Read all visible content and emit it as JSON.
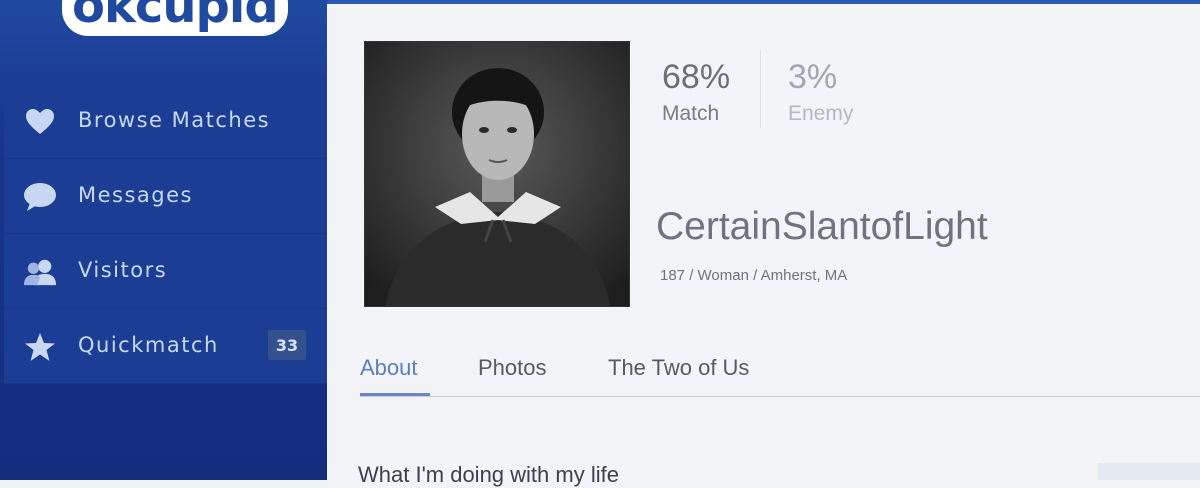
{
  "app": {
    "logo_text": "okcupid"
  },
  "sidebar": {
    "items": [
      {
        "label": "Browse Matches",
        "icon": "heart-icon"
      },
      {
        "label": "Messages",
        "icon": "chat-bubble-icon"
      },
      {
        "label": "Visitors",
        "icon": "people-icon"
      },
      {
        "label": "Quickmatch",
        "icon": "star-icon",
        "count": "33"
      }
    ]
  },
  "profile": {
    "stats": {
      "match_value": "68%",
      "match_label": "Match",
      "enemy_value": "3%",
      "enemy_label": "Enemy"
    },
    "username": "CertainSlantofLight",
    "details": "187 / Woman / Amherst, MA"
  },
  "tabs": [
    {
      "label": "About",
      "active": true
    },
    {
      "label": "Photos",
      "active": false
    },
    {
      "label": "The Two of Us",
      "active": false
    }
  ],
  "content": {
    "section_heading": "What I'm doing with my life"
  },
  "colors": {
    "sidebar": "#17358a",
    "accent": "#2d59b5",
    "active_tab": "#5d7ebd"
  }
}
